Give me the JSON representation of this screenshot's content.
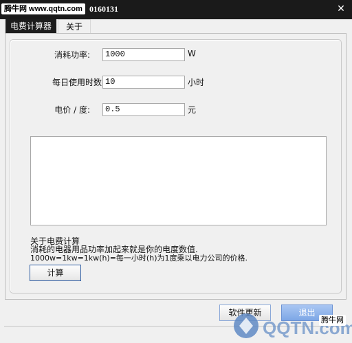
{
  "titlebar": {
    "watermark_text": "腾牛网 www.qqtn.com",
    "title_rest": "0160131",
    "close_glyph": "✕"
  },
  "tabs": [
    {
      "label": "电费计算器",
      "active": true
    },
    {
      "label": "关于",
      "active": false
    }
  ],
  "form": {
    "power": {
      "label": "消耗功率:",
      "value": "1000",
      "unit": "W"
    },
    "hours": {
      "label": "每日使用时数:",
      "value": "10",
      "unit": "小时"
    },
    "price": {
      "label": "电价 / 度:",
      "value": "0.5",
      "unit": "元"
    }
  },
  "result": {
    "value": ""
  },
  "info": {
    "line1": "关于电费计算",
    "line2": "消耗的电器用品功率加起来就是你的电度数值.",
    "line3": "1000w=1kw=1kw(h)=每一小时(h)为1度乘以电力公司的价格."
  },
  "buttons": {
    "calc": "计算",
    "update": "软件更新",
    "exit": "退出"
  },
  "watermark": {
    "logo_text": "QQTN.com",
    "tag_text": "腾牛网"
  },
  "colors": {
    "titlebar": "#1a1a1a",
    "accent_border": "#2b5aa0",
    "exit_button": "#7da7e6"
  }
}
